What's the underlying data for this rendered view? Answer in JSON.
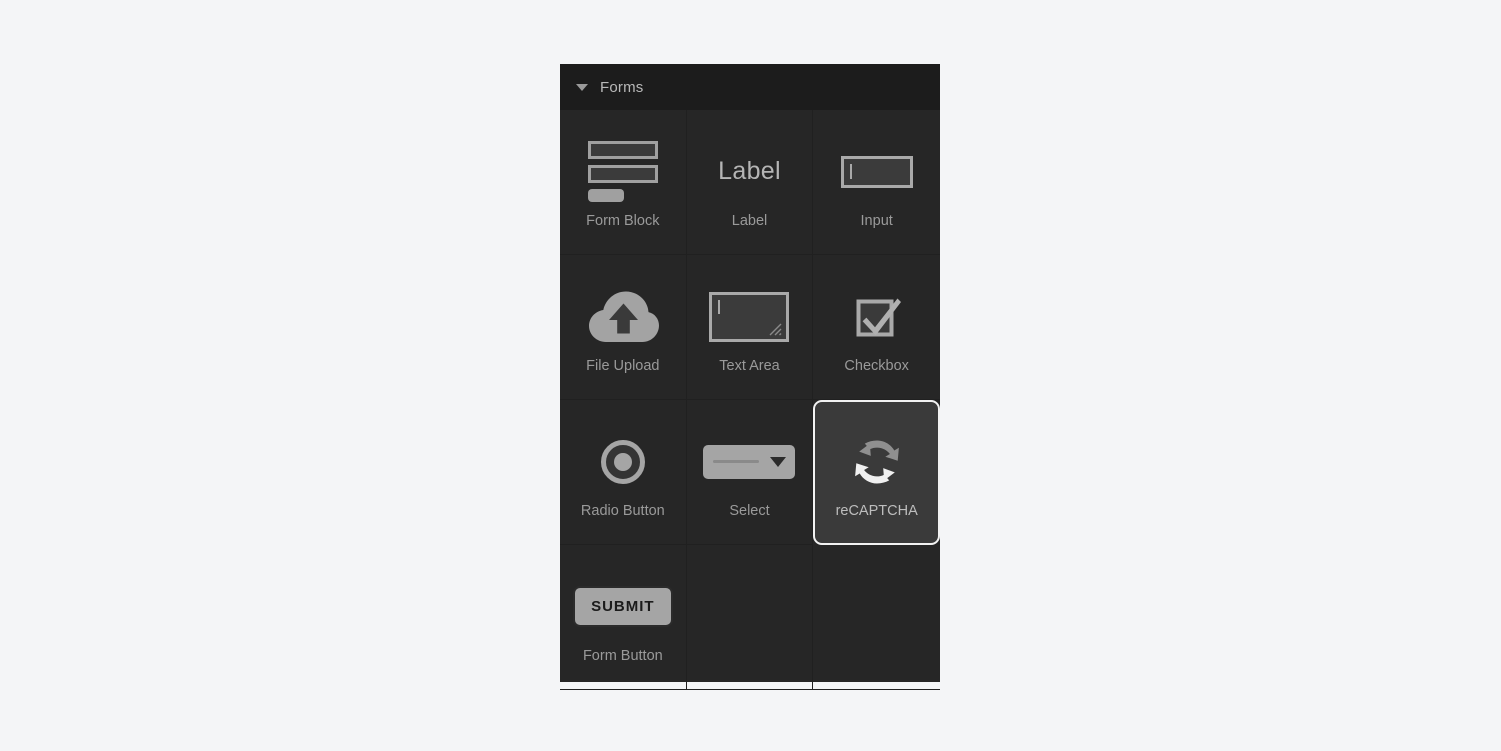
{
  "canvas": {
    "background_color": "#f4f5f7"
  },
  "panel": {
    "title": "Forms",
    "disclosure_icon": "triangle-down-icon",
    "header_color": "#1c1c1c",
    "body_color": "#262626",
    "selection_border_color": "#f2f2f2",
    "selected_item": "reCAPTCHA"
  },
  "items": [
    {
      "label": "Form Block",
      "icon": "form-block-icon",
      "selected": false
    },
    {
      "label": "Label",
      "icon": "label-text-icon",
      "icon_text": "Label",
      "selected": false
    },
    {
      "label": "Input",
      "icon": "text-input-icon",
      "selected": false
    },
    {
      "label": "File Upload",
      "icon": "cloud-upload-icon",
      "selected": false
    },
    {
      "label": "Text Area",
      "icon": "text-area-icon",
      "selected": false
    },
    {
      "label": "Checkbox",
      "icon": "checkbox-icon",
      "selected": false
    },
    {
      "label": "Radio Button",
      "icon": "radio-button-icon",
      "selected": false
    },
    {
      "label": "Select",
      "icon": "select-dropdown-icon",
      "selected": false
    },
    {
      "label": "reCAPTCHA",
      "icon": "recaptcha-refresh-icon",
      "selected": true
    },
    {
      "label": "Form Button",
      "icon": "submit-button-icon",
      "icon_text": "SUBMIT",
      "selected": false
    }
  ]
}
